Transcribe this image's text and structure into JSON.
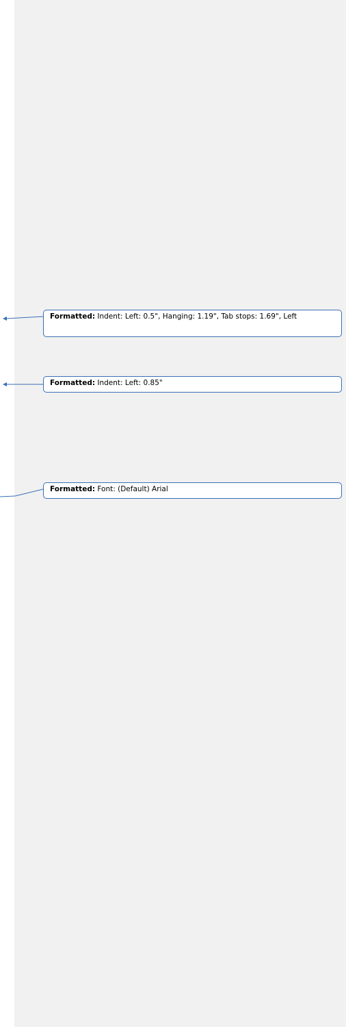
{
  "colors": {
    "pane_background": "#f1f1f1",
    "balloon_border": "#3a6fb5",
    "connector_line": "#3a6fb5"
  },
  "comments": [
    {
      "label": "Formatted:",
      "text": " Indent: Left:  0.5\", Hanging:  1.19\", Tab stops: 1.69\", Left"
    },
    {
      "label": "Formatted:",
      "text": " Indent: Left:  0.85\""
    },
    {
      "label": "Formatted:",
      "text": " Font: (Default) Arial"
    }
  ]
}
